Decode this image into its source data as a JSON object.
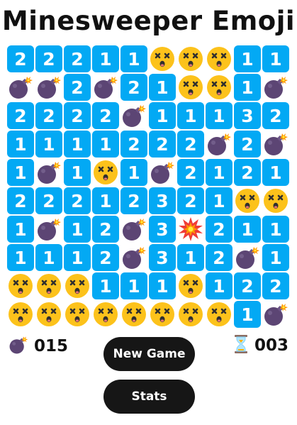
{
  "title": "Minesweeper Emoji",
  "board": {
    "rows": [
      [
        "2",
        "2",
        "2",
        "1",
        "1",
        "face",
        "face",
        "face",
        "1",
        "1"
      ],
      [
        "bomb",
        "bomb",
        "2",
        "bomb",
        "2",
        "1",
        "face",
        "face",
        "1",
        "bomb"
      ],
      [
        "2",
        "2",
        "2",
        "2",
        "bomb",
        "1",
        "1",
        "1",
        "3",
        "2"
      ],
      [
        "1",
        "1",
        "1",
        "1",
        "2",
        "2",
        "2",
        "bomb",
        "2",
        "bomb"
      ],
      [
        "1",
        "bomb",
        "1",
        "face",
        "1",
        "bomb",
        "2",
        "1",
        "2",
        "1"
      ],
      [
        "2",
        "2",
        "2",
        "1",
        "2",
        "3",
        "2",
        "1",
        "face",
        "face"
      ],
      [
        "1",
        "bomb",
        "1",
        "2",
        "bomb",
        "3",
        "explosion",
        "2",
        "1",
        "1"
      ],
      [
        "1",
        "1",
        "1",
        "2",
        "bomb",
        "3",
        "1",
        "2",
        "bomb",
        "1"
      ],
      [
        "face",
        "face",
        "face",
        "1",
        "1",
        "1",
        "face",
        "1",
        "2",
        "2"
      ],
      [
        "face",
        "face",
        "face",
        "face",
        "face",
        "face",
        "face",
        "face",
        "1",
        "bomb"
      ]
    ]
  },
  "status": {
    "mine_count": "015",
    "timer": "003",
    "mine_icon": "bomb-icon",
    "timer_icon": "hourglass-icon"
  },
  "buttons": {
    "new_game": "New Game",
    "stats": "Stats"
  },
  "colors": {
    "number_tile": "#03a9f4",
    "button_bg": "#161616",
    "face": "#fcc21b",
    "bomb": "#5c4574"
  }
}
